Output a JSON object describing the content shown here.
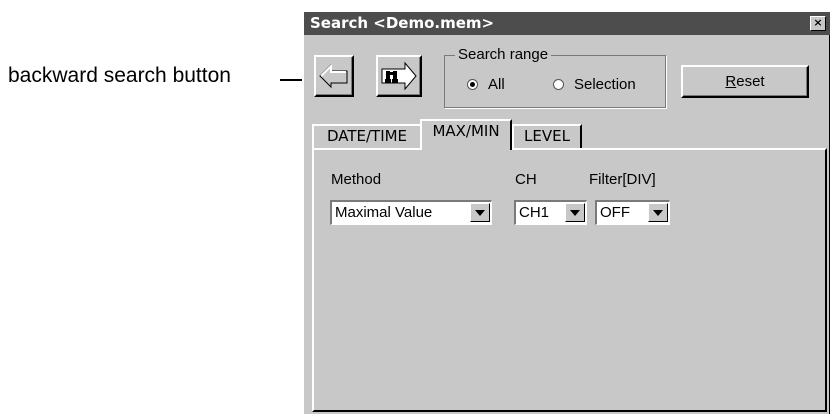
{
  "callout": {
    "label": "backward search button"
  },
  "window": {
    "title": "Search <Demo.mem>",
    "close_glyph": "×"
  },
  "toolbar": {
    "back_icon": "left-arrow-icon",
    "forward_icon": "binoculars-right-arrow-icon"
  },
  "search_range": {
    "legend": "Search range",
    "options": [
      {
        "label": "All",
        "selected": true
      },
      {
        "label": "Selection",
        "selected": false
      }
    ]
  },
  "reset": {
    "mnemonic": "R",
    "rest": "eset"
  },
  "tabs": [
    {
      "label": "DATE/TIME",
      "active": false
    },
    {
      "label": "MAX/MIN",
      "active": true
    },
    {
      "label": "LEVEL",
      "active": false
    }
  ],
  "fields": {
    "method": {
      "label": "Method",
      "value": "Maximal Value"
    },
    "ch": {
      "label": "CH",
      "value": "CH1"
    },
    "filter": {
      "label": "Filter[DIV]",
      "value": "OFF"
    }
  },
  "colors": {
    "face": "#c8c8c8",
    "titlebar": "#4d4d4d",
    "highlight": "#ffffff",
    "shadow": "#000000"
  }
}
